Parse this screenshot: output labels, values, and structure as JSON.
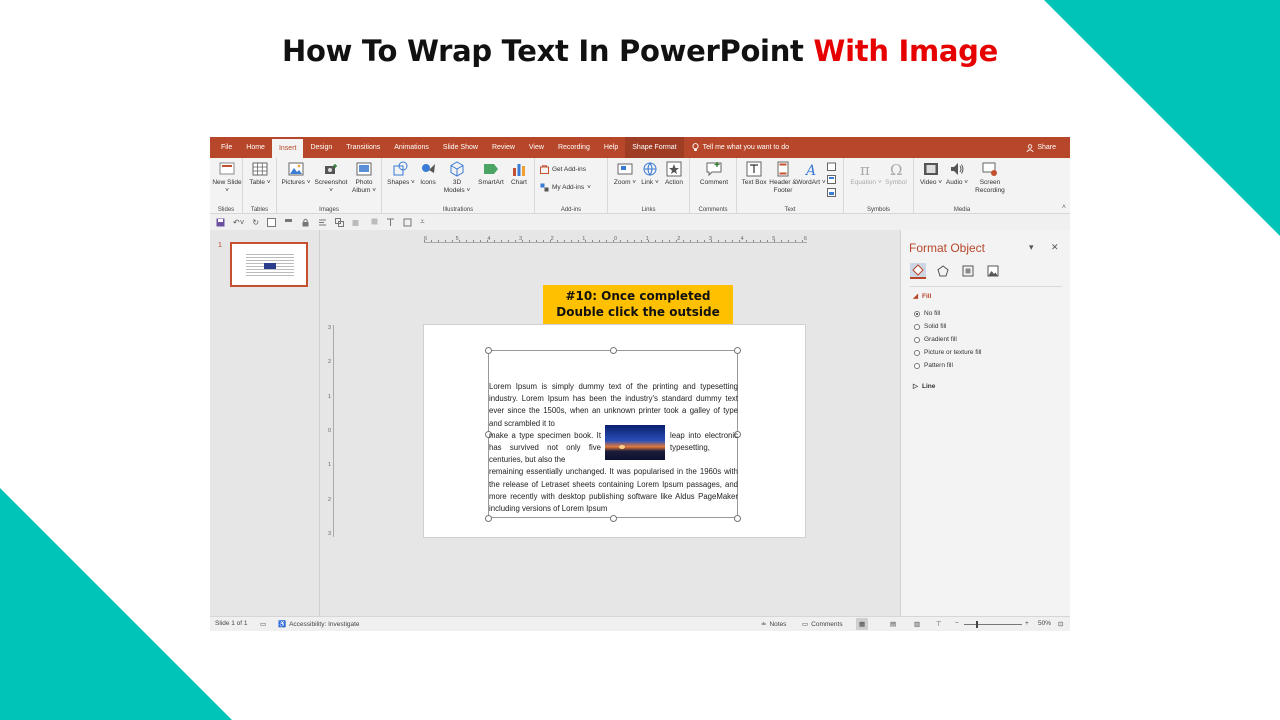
{
  "headline": {
    "part1": "How To Wrap Text In PowerPoint ",
    "part2": "With Image"
  },
  "colors": {
    "accent": "#e60000",
    "teal": "#00c4b8",
    "ppt_brand": "#b7472a",
    "callout": "#ffc000"
  },
  "tabs": [
    "File",
    "Home",
    "Insert",
    "Design",
    "Transitions",
    "Animations",
    "Slide Show",
    "Review",
    "View",
    "Recording",
    "Help",
    "Shape Format"
  ],
  "active_tab": "Insert",
  "tell_me": "Tell me what you want to do",
  "share": "Share",
  "ribbon": {
    "groups": {
      "slides": "Slides",
      "tables": "Tables",
      "images": "Images",
      "illustrations": "Illustrations",
      "addins": "Add-ins",
      "links": "Links",
      "comments": "Comments",
      "text": "Text",
      "symbols": "Symbols",
      "media": "Media"
    },
    "buttons": {
      "new_slide": "New Slide ˅",
      "table": "Table ˅",
      "pictures": "Pictures ˅",
      "screenshot": "Screenshot ˅",
      "photo_album": "Photo Album ˅",
      "shapes": "Shapes ˅",
      "icons": "Icons",
      "models_3d": "3D Models ˅",
      "smartart": "SmartArt",
      "chart": "Chart",
      "get_addins": "Get Add-ins",
      "my_addins": "My Add-ins",
      "zoom": "Zoom ˅",
      "link": "Link ˅",
      "action": "Action",
      "comment": "Comment",
      "text_box": "Text Box",
      "header_footer": "Header & Footer",
      "wordart": "WordArt ˅",
      "equation": "Equation ˅",
      "symbol": "Symbol",
      "video": "Video ˅",
      "audio": "Audio ˅",
      "screen_recording": "Screen Recording"
    }
  },
  "thumbnail": {
    "number": "1"
  },
  "ruler": {
    "h": [
      "6",
      "5",
      "4",
      "3",
      "2",
      "1",
      "0",
      "1",
      "2",
      "3",
      "4",
      "5",
      "6"
    ],
    "v": [
      "3",
      "2",
      "1",
      "0",
      "1",
      "2",
      "3"
    ]
  },
  "callout": {
    "line1": "#10: Once completed",
    "line2": "Double click the outside"
  },
  "lorem": {
    "l1": "Lorem Ipsum is simply dummy text of the printing and typesetting industry. Lorem Ipsum has been the industry's standard dummy text ever since the 1500s, when an unknown printer took a galley of type and scrambled it to",
    "l2": "make a type specimen book. It has",
    "l3": "survived not only five centuries, but also the",
    "l4": "leap into electronic typesetting,",
    "l5": "remaining essentially unchanged. It was popularised in the 1960s with the release of Letraset sheets containing Lorem Ipsum passages, and more recently with desktop publishing software like Aldus PageMaker including versions of Lorem Ipsum"
  },
  "format_pane": {
    "title": "Format Object",
    "fill_section": "Fill",
    "line_section": "Line",
    "fill_options": [
      "No fill",
      "Solid fill",
      "Gradient fill",
      "Picture or texture fill",
      "Pattern fill"
    ],
    "selected_fill": "No fill"
  },
  "status": {
    "slide": "Slide 1 of 1",
    "accessibility": "Accessibility: Investigate",
    "notes": "Notes",
    "comments": "Comments",
    "zoom": "50%"
  }
}
